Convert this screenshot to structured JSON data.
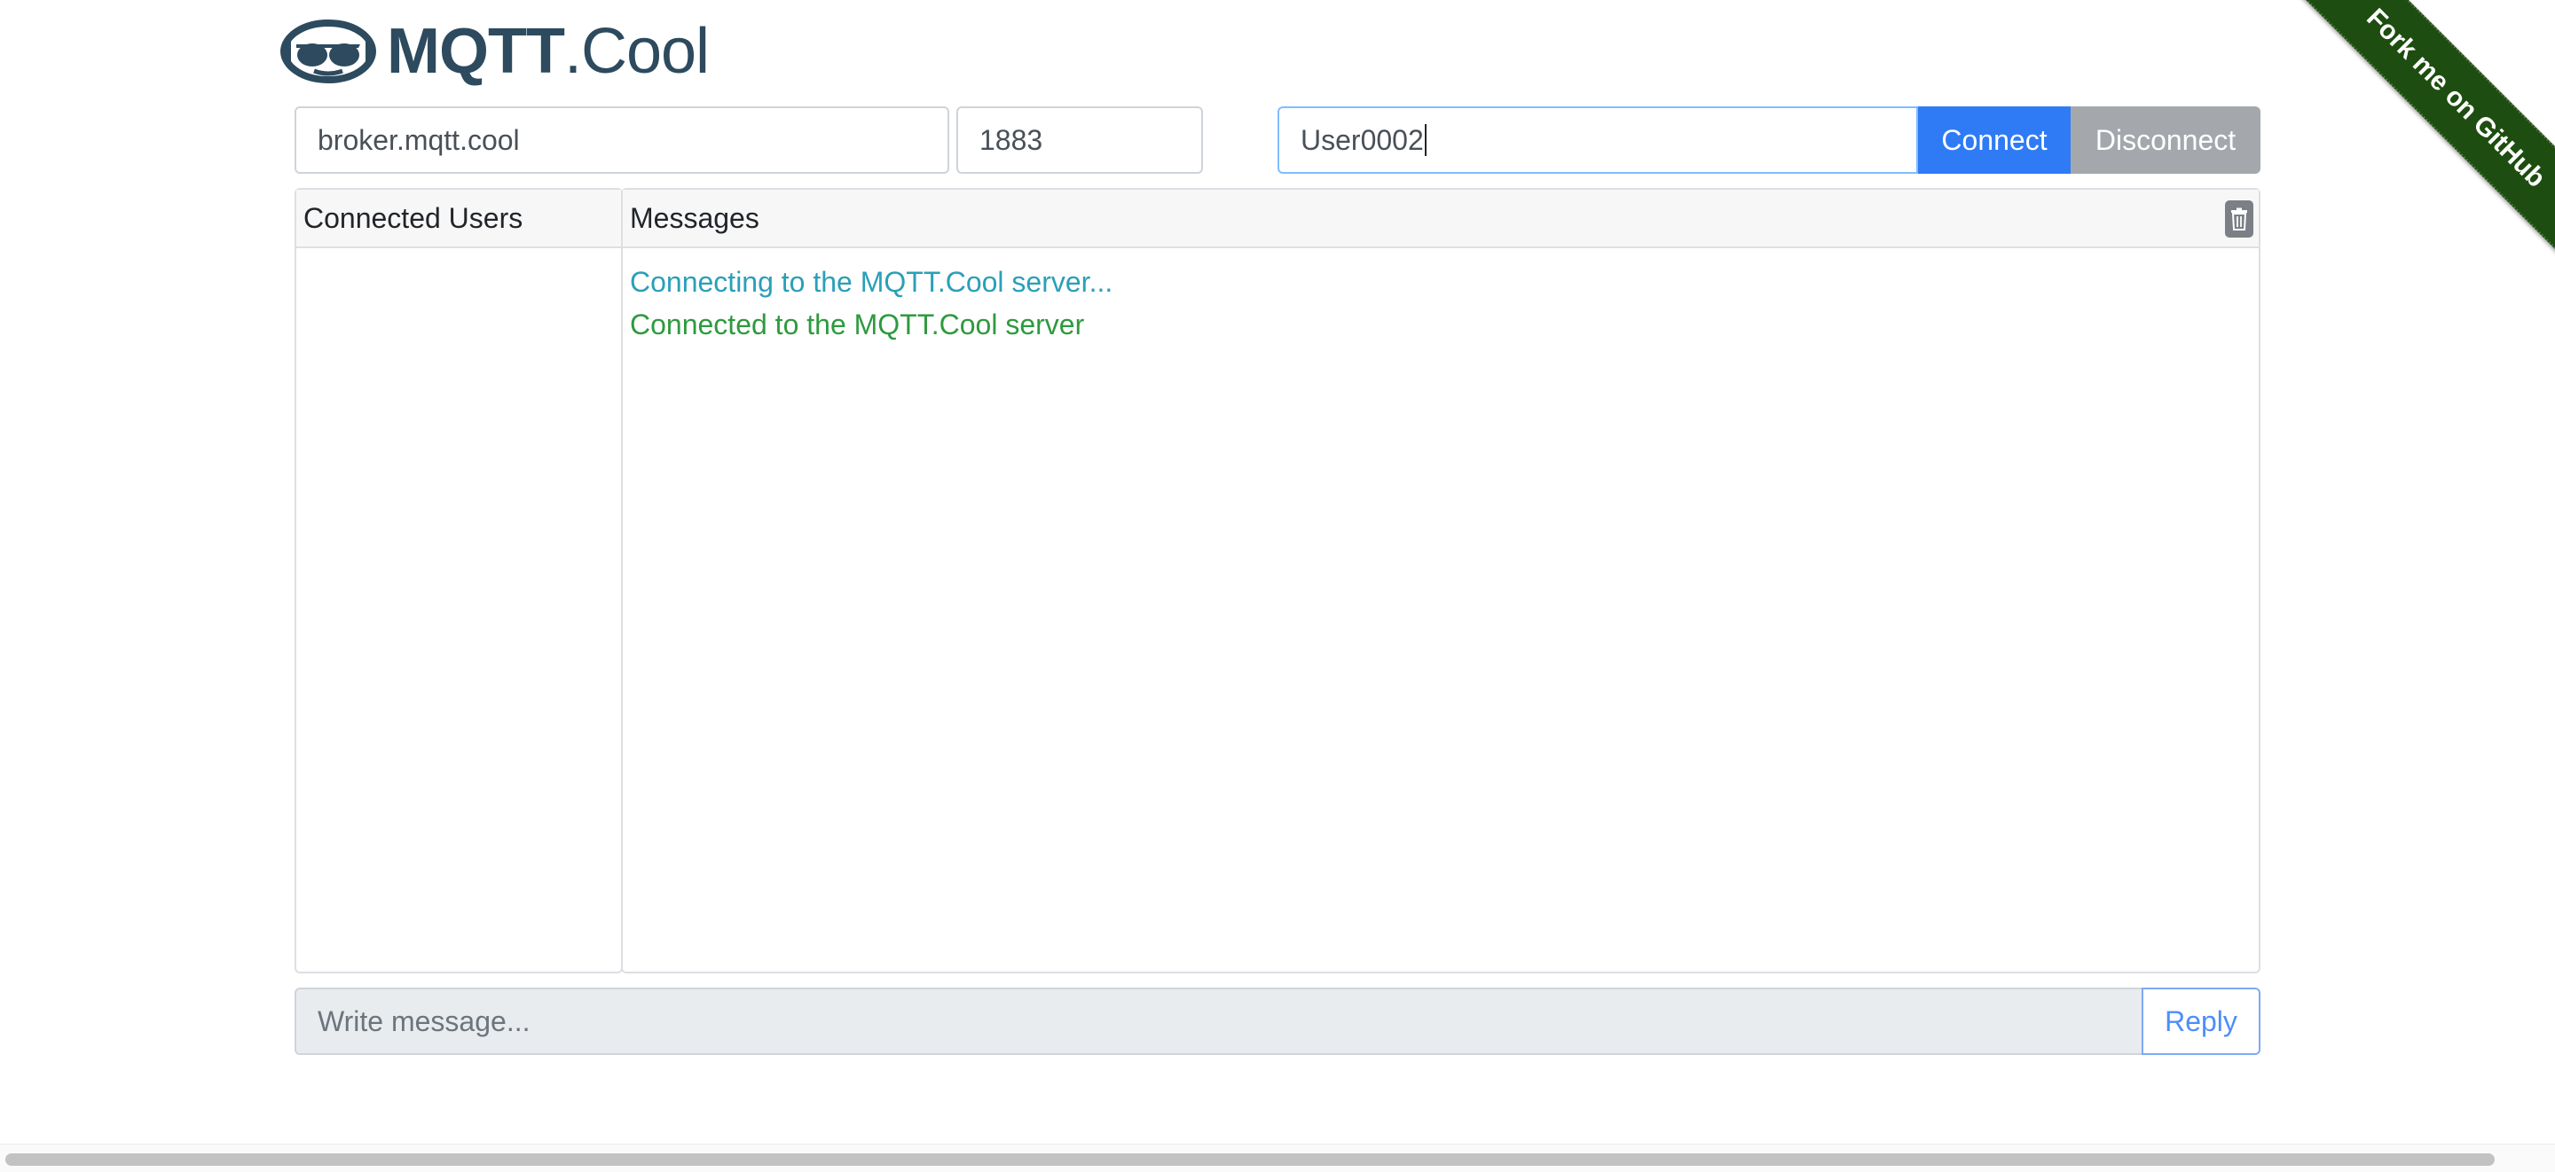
{
  "logo": {
    "bold_text": "MQTT",
    "light_text": ".Cool",
    "icon": "sunglasses-face-icon",
    "color": "#2d4a5e"
  },
  "ribbon": {
    "label": "Fork me on GitHub",
    "color": "#1d4d10"
  },
  "connection": {
    "host_value": "broker.mqtt.cool",
    "port_value": "1883",
    "user_value": "User0002",
    "connect_label": "Connect",
    "disconnect_label": "Disconnect",
    "connect_color": "#2f7bf5",
    "disconnect_color": "#a4a8ad"
  },
  "users_panel": {
    "header": "Connected Users",
    "users": []
  },
  "messages_panel": {
    "header": "Messages",
    "clear_icon": "trash-icon",
    "messages": [
      {
        "text": "Connecting to the MQTT.Cool server...",
        "type": "info",
        "color": "#2a9fb8"
      },
      {
        "text": "Connected to the MQTT.Cool server",
        "type": "success",
        "color": "#2e9a3e"
      }
    ]
  },
  "composer": {
    "placeholder": "Write message...",
    "reply_label": "Reply"
  }
}
